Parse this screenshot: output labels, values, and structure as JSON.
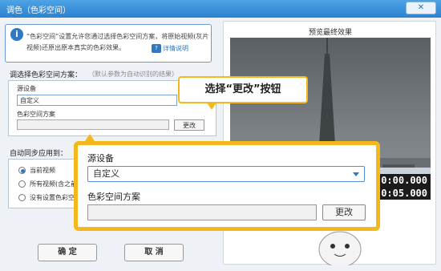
{
  "window": {
    "title": "调色（色彩空间）",
    "close_label": "✕"
  },
  "notice": {
    "text": "“色彩空间”设置允许您通过选择色彩空间方案，将原始视频(灰片视频)还原出原本真实的色彩效果。",
    "help_label": "详情说明"
  },
  "color_space": {
    "section_title": "调选择色彩空间方案：",
    "section_hint": "（默认参数为自动识别的结果）",
    "source_label": "源设备",
    "source_value": "自定义",
    "scheme_label": "色彩空间方案",
    "change_label": "更改"
  },
  "sync": {
    "section_title": "自动同步应用到：",
    "options": [
      "当前视频",
      "所有视频(含之前",
      "没有设置色彩空"
    ]
  },
  "buttons": {
    "ok": "确 定",
    "cancel": "取 消"
  },
  "preview": {
    "title": "预览最终效果",
    "time_top": "0:00.000",
    "time_bottom": "0:05.000"
  },
  "callout": {
    "text": "选择“更改”按钮"
  },
  "zoom": {
    "source_label": "源设备",
    "source_value": "自定义",
    "scheme_label": "色彩空间方案",
    "change_label": "更改"
  }
}
